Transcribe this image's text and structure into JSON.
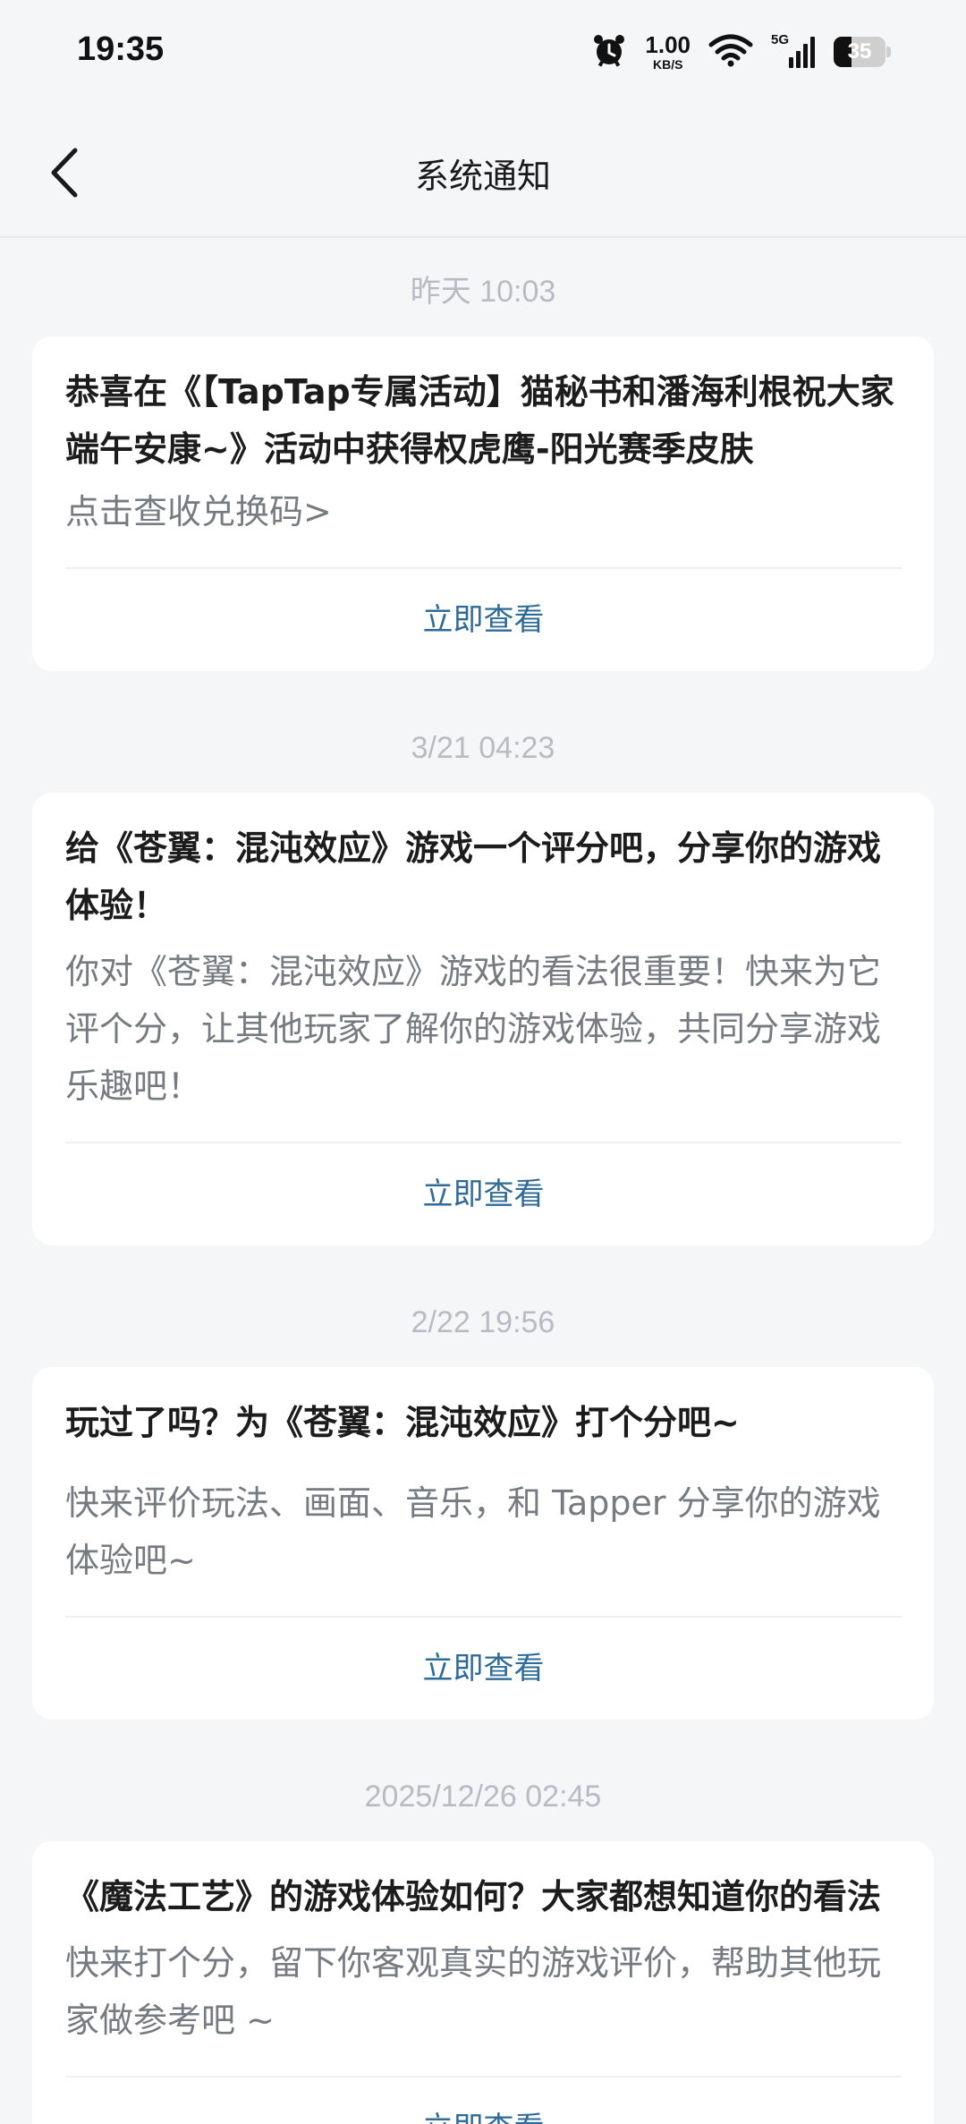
{
  "status_bar": {
    "time": "19:35",
    "net_speed_value": "1.00",
    "net_speed_unit": "KB/S",
    "network_type": "5G",
    "battery_level": "35",
    "battery_fraction": 0.35
  },
  "header": {
    "title": "系统通知"
  },
  "notifications": [
    {
      "timestamp": "昨天 10:03",
      "title": "恭喜在《【TapTap专属活动】猫秘书和潘海利根祝大家端午安康~》活动中获得权虎鹰-阳光赛季皮肤",
      "body": "点击查收兑换码>",
      "action": "立即查看"
    },
    {
      "timestamp": "3/21 04:23",
      "title": "给《苍翼：混沌效应》游戏一个评分吧，分享你的游戏体验！",
      "body": "你对《苍翼：混沌效应》游戏的看法很重要！快来为它评个分，让其他玩家了解你的游戏体验，共同分享游戏乐趣吧！",
      "action": "立即查看"
    },
    {
      "timestamp": "2/22 19:56",
      "title": "玩过了吗？为《苍翼：混沌效应》打个分吧~",
      "body": "快来评价玩法、画面、音乐，和 Tapper 分享你的游戏体验吧~",
      "action": "立即查看"
    },
    {
      "timestamp": "2025/12/26 02:45",
      "title": "《魔法工艺》的游戏体验如何？大家都想知道你的看法",
      "body": "快来打个分，留下你客观真实的游戏评价，帮助其他玩家做参考吧 ~",
      "action": "立即查看"
    }
  ]
}
